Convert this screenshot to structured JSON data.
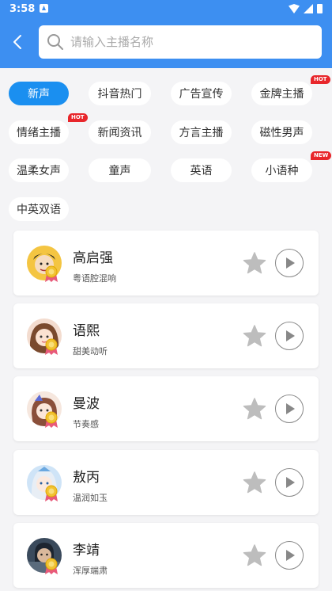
{
  "status": {
    "time": "3:58"
  },
  "search": {
    "placeholder": "请输入主播名称"
  },
  "categories": [
    {
      "label": "新声",
      "active": true
    },
    {
      "label": "抖音热门"
    },
    {
      "label": "广告宣传"
    },
    {
      "label": "金牌主播",
      "badge": "HOT"
    },
    {
      "label": "情绪主播",
      "badge": "HOT"
    },
    {
      "label": "新闻资讯"
    },
    {
      "label": "方言主播"
    },
    {
      "label": "磁性男声"
    },
    {
      "label": "温柔女声"
    },
    {
      "label": "童声"
    },
    {
      "label": "英语"
    },
    {
      "label": "小语种",
      "badge": "NEW"
    },
    {
      "label": "中英双语"
    }
  ],
  "anchors": [
    {
      "name": "高启强",
      "desc": "粤语腔混响"
    },
    {
      "name": "语熙",
      "desc": "甜美动听"
    },
    {
      "name": "曼波",
      "desc": "节奏感"
    },
    {
      "name": "敖丙",
      "desc": "温润如玉"
    },
    {
      "name": "李靖",
      "desc": "浑厚端肃"
    }
  ],
  "colors": {
    "accent": "#3d8ff1",
    "chip_active": "#1a8ff0",
    "badge": "#e8262b",
    "star": "#bdbdbd"
  }
}
